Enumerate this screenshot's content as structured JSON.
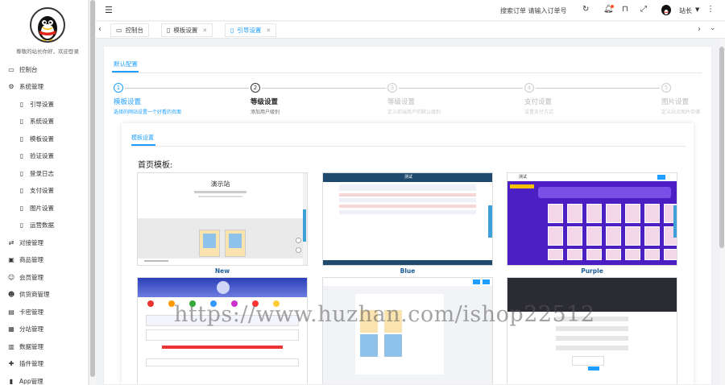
{
  "sidebar": {
    "welcome": "尊敬的站长你好，欢迎登录",
    "items": [
      {
        "label": "控制台",
        "icon": "monitor-icon",
        "sub": false
      },
      {
        "label": "系统管理",
        "icon": "gear-icon",
        "sub": false
      },
      {
        "label": "引导设置",
        "icon": "document-icon",
        "sub": true
      },
      {
        "label": "系统设置",
        "icon": "document-icon",
        "sub": true
      },
      {
        "label": "模板设置",
        "icon": "document-icon",
        "sub": true
      },
      {
        "label": "验证设置",
        "icon": "document-icon",
        "sub": true
      },
      {
        "label": "登录日志",
        "icon": "document-icon",
        "sub": true
      },
      {
        "label": "支付设置",
        "icon": "document-icon",
        "sub": true
      },
      {
        "label": "图片设置",
        "icon": "document-icon",
        "sub": true
      },
      {
        "label": "运营数据",
        "icon": "document-icon",
        "sub": true
      },
      {
        "label": "对接管理",
        "icon": "link-icon",
        "sub": false
      },
      {
        "label": "商品管理",
        "icon": "box-icon",
        "sub": false
      },
      {
        "label": "会员管理",
        "icon": "users-icon",
        "sub": false
      },
      {
        "label": "供货商管理",
        "icon": "user-icon",
        "sub": false
      },
      {
        "label": "卡密管理",
        "icon": "card-icon",
        "sub": false
      },
      {
        "label": "分站管理",
        "icon": "grid-icon",
        "sub": false
      },
      {
        "label": "数据管理",
        "icon": "chart-icon",
        "sub": false
      },
      {
        "label": "插件管理",
        "icon": "plugin-icon",
        "sub": false
      },
      {
        "label": "App管理",
        "icon": "phone-icon",
        "sub": false
      }
    ]
  },
  "header": {
    "search_order": "搜索订单 请输入订单号",
    "user_name": "站长"
  },
  "tabs": [
    {
      "label": "控制台",
      "icon": "monitor-icon",
      "closable": false,
      "active": false
    },
    {
      "label": "模板设置",
      "icon": "document-icon",
      "closable": true,
      "active": false
    },
    {
      "label": "引导设置",
      "icon": "document-icon",
      "closable": true,
      "active": true
    }
  ],
  "content": {
    "tab_default": "默认配置",
    "steps": [
      {
        "num": "1",
        "title": "模板设置",
        "desc": "选择的网站设置一个好看的页面",
        "state": "done"
      },
      {
        "num": "2",
        "title": "等级设置",
        "desc": "添加用户级别",
        "state": "current"
      },
      {
        "num": "3",
        "title": "等级设置",
        "desc": "定义前端用户的默认级别",
        "state": "todo"
      },
      {
        "num": "4",
        "title": "支付设置",
        "desc": "设置支付方式",
        "state": "todo"
      },
      {
        "num": "5",
        "title": "图片设置",
        "desc": "定义站点图片存储",
        "state": "todo"
      }
    ],
    "inner_tab": "模板设置",
    "home_label": "首页模板:",
    "templates": [
      {
        "name": "New",
        "preview_title": "演示站"
      },
      {
        "name": "Blue",
        "preview_title": "测试"
      },
      {
        "name": "Purple",
        "preview_title": "测试"
      }
    ],
    "watermark": "https://www.huzhan.com/ishop22512"
  },
  "colors": {
    "accent": "#1e9fff",
    "label": "#1f5f9a",
    "purple": "#5b2be0"
  }
}
